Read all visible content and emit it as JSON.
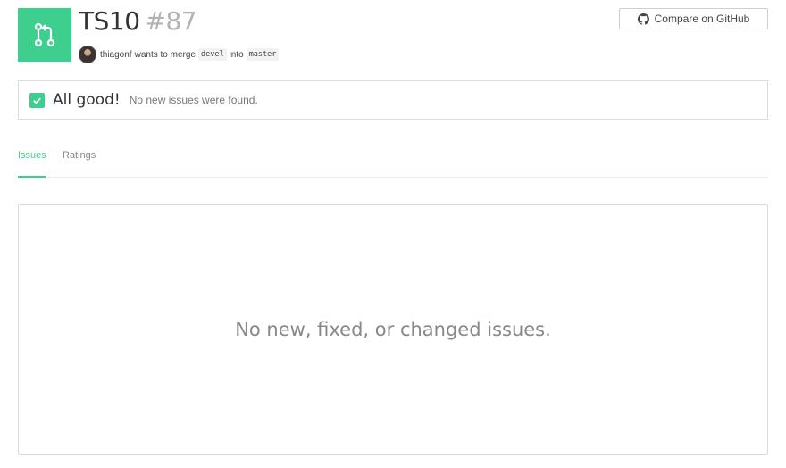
{
  "pr": {
    "repo": "TS10",
    "number": "#87",
    "author": "thiagonf",
    "merge_text": "wants to merge",
    "source_branch": "devel",
    "into_text": "into",
    "target_branch": "master",
    "icon": "pull-request-icon",
    "icon_bg": "#3ecf8e"
  },
  "actions": {
    "compare_label": "Compare on GitHub",
    "compare_icon": "github-icon"
  },
  "status": {
    "title": "All good!",
    "message": "No new issues were found.",
    "icon": "check-icon"
  },
  "tabs": [
    {
      "label": "Issues",
      "active": true
    },
    {
      "label": "Ratings",
      "active": false
    }
  ],
  "issues_panel": {
    "empty_message": "No new, fixed, or changed issues."
  },
  "colors": {
    "accent": "#3ecf8e",
    "muted": "#888888"
  }
}
